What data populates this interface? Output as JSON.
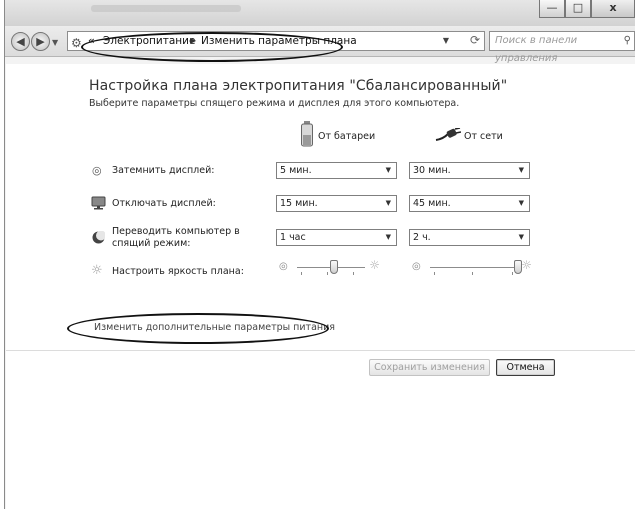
{
  "window": {
    "caption_buttons": {
      "minimize": "—",
      "maximize": "□",
      "close": "x"
    }
  },
  "nav": {
    "back_icon": "back-arrow-icon",
    "forward_icon": "forward-arrow-icon",
    "breadcrumb": [
      {
        "label": "Электропитание"
      },
      {
        "label": "Изменить параметры плана"
      }
    ],
    "search_placeholder": "Поиск в панели управления"
  },
  "page": {
    "title": "Настройка плана электропитания \"Сбалансированный\"",
    "subtitle": "Выберите параметры спящего режима и дисплея для этого компьютера.",
    "col_battery": "От батареи",
    "col_ac": "От сети"
  },
  "rows": {
    "dim": {
      "label": "Затемнить дисплей:",
      "battery": "5 мин.",
      "ac": "30 мин."
    },
    "off": {
      "label": "Отключать дисплей:",
      "battery": "15 мин.",
      "ac": "45 мин."
    },
    "sleep": {
      "label": "Переводить компьютер в спящий режим:",
      "battery": "1 час",
      "ac": "2 ч."
    },
    "brightness": {
      "label": "Настроить яркость плана:",
      "battery_level": 0.55,
      "ac_level": 1.0
    }
  },
  "link_advanced": "Изменить дополнительные параметры питания",
  "buttons": {
    "save": "Сохранить изменения",
    "cancel": "Отмена"
  },
  "colors": {
    "text": "#222222",
    "disabled_text": "#a0a0a0",
    "window_bg": "#f3f3f3"
  }
}
